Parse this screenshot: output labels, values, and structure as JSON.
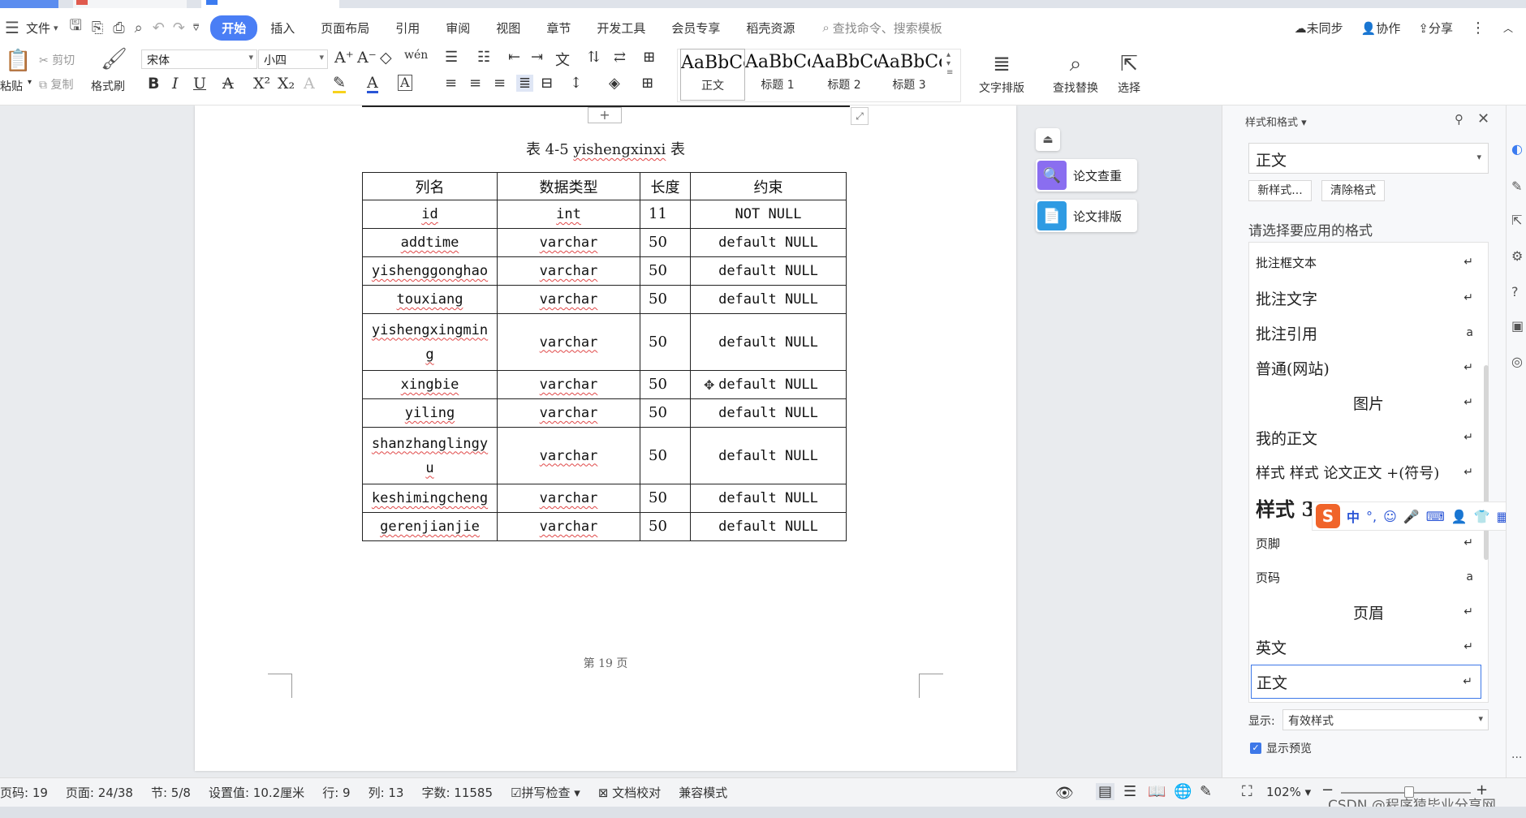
{
  "menu": {
    "file": "文件",
    "tabs": [
      "开始",
      "插入",
      "页面布局",
      "引用",
      "审阅",
      "视图",
      "章节",
      "开发工具",
      "会员专享",
      "稻壳资源"
    ],
    "search_placeholder": "查找命令、搜索模板",
    "right": [
      "未同步",
      "协作",
      "分享"
    ]
  },
  "ribbon": {
    "paste": "粘贴",
    "cut": "剪切",
    "copy": "复制",
    "format_painter": "格式刷",
    "font_name": "宋体",
    "font_size": "小四",
    "styles": [
      {
        "preview": "AaBbCcI",
        "name": "正文"
      },
      {
        "preview": "AaBbCcI",
        "name": "标题 1"
      },
      {
        "preview": "AaBbCcI",
        "name": "标题 2"
      },
      {
        "preview": "AaBbCc",
        "name": "标题 3"
      }
    ],
    "text_layout": "文字排版",
    "find_replace": "查找替换",
    "select": "选择"
  },
  "document": {
    "caption_prefix": "表 4-5 ",
    "caption_name": "yishengxinxi",
    "caption_suffix": " 表",
    "table": {
      "headers": [
        "列名",
        "数据类型",
        "长度",
        "约束"
      ],
      "rows": [
        [
          "id",
          "int",
          "11",
          "NOT NULL"
        ],
        [
          "addtime",
          "varchar",
          "50",
          "default NULL"
        ],
        [
          "yishenggonghao",
          "varchar",
          "50",
          "default NULL"
        ],
        [
          "touxiang",
          "varchar",
          "50",
          "default NULL"
        ],
        [
          "yishengxingmin\ng",
          "varchar",
          "50",
          "default NULL"
        ],
        [
          "xingbie",
          "varchar",
          "50",
          "default NULL"
        ],
        [
          "yiling",
          "varchar",
          "50",
          "default NULL"
        ],
        [
          "shanzhanglingy\nu",
          "varchar",
          "50",
          "default NULL"
        ],
        [
          "keshimingcheng",
          "varchar",
          "50",
          "default NULL"
        ],
        [
          "gerenjianjie",
          "varchar",
          "50",
          "default NULL"
        ]
      ]
    },
    "page_number": "第 19 页"
  },
  "float_buttons": {
    "check": "论文查重",
    "layout": "论文排版"
  },
  "styles_panel": {
    "title": "样式和格式",
    "current": "正文",
    "new_style": "新样式...",
    "clear_format": "清除格式",
    "prompt": "请选择要应用的格式",
    "items": [
      {
        "name": "批注框文本",
        "mark": "↵"
      },
      {
        "name": "批注文字",
        "mark": "↵"
      },
      {
        "name": "批注引用",
        "mark": "a"
      },
      {
        "name": "普通(网站)",
        "mark": "↵"
      },
      {
        "name": "图片",
        "mark": "↵"
      },
      {
        "name": "我的正文",
        "mark": "↵"
      },
      {
        "name": "样式 样式 论文正文 +(符号)",
        "mark": "↵"
      },
      {
        "name": "样式 3",
        "mark": ""
      },
      {
        "name": "页脚",
        "mark": "↵"
      },
      {
        "name": "页码",
        "mark": "a"
      },
      {
        "name": "页眉",
        "mark": "↵"
      },
      {
        "name": "英文",
        "mark": "↵"
      },
      {
        "name": "正文",
        "mark": "↵"
      }
    ],
    "show_label": "显示:",
    "show_value": "有效样式",
    "preview_label": "显示预览"
  },
  "ime_bar": {
    "lang": "中"
  },
  "status": {
    "page_code": "页码: 19",
    "pages": "页面: 24/38",
    "section": "节: 5/8",
    "setting": "设置值: 10.2厘米",
    "row": "行: 9",
    "col": "列: 13",
    "words": "字数: 11585",
    "spell": "拼写检查",
    "proof": "文档校对",
    "compat": "兼容模式",
    "zoom": "102%"
  },
  "watermark": "CSDN @程序猿毕业分享网"
}
